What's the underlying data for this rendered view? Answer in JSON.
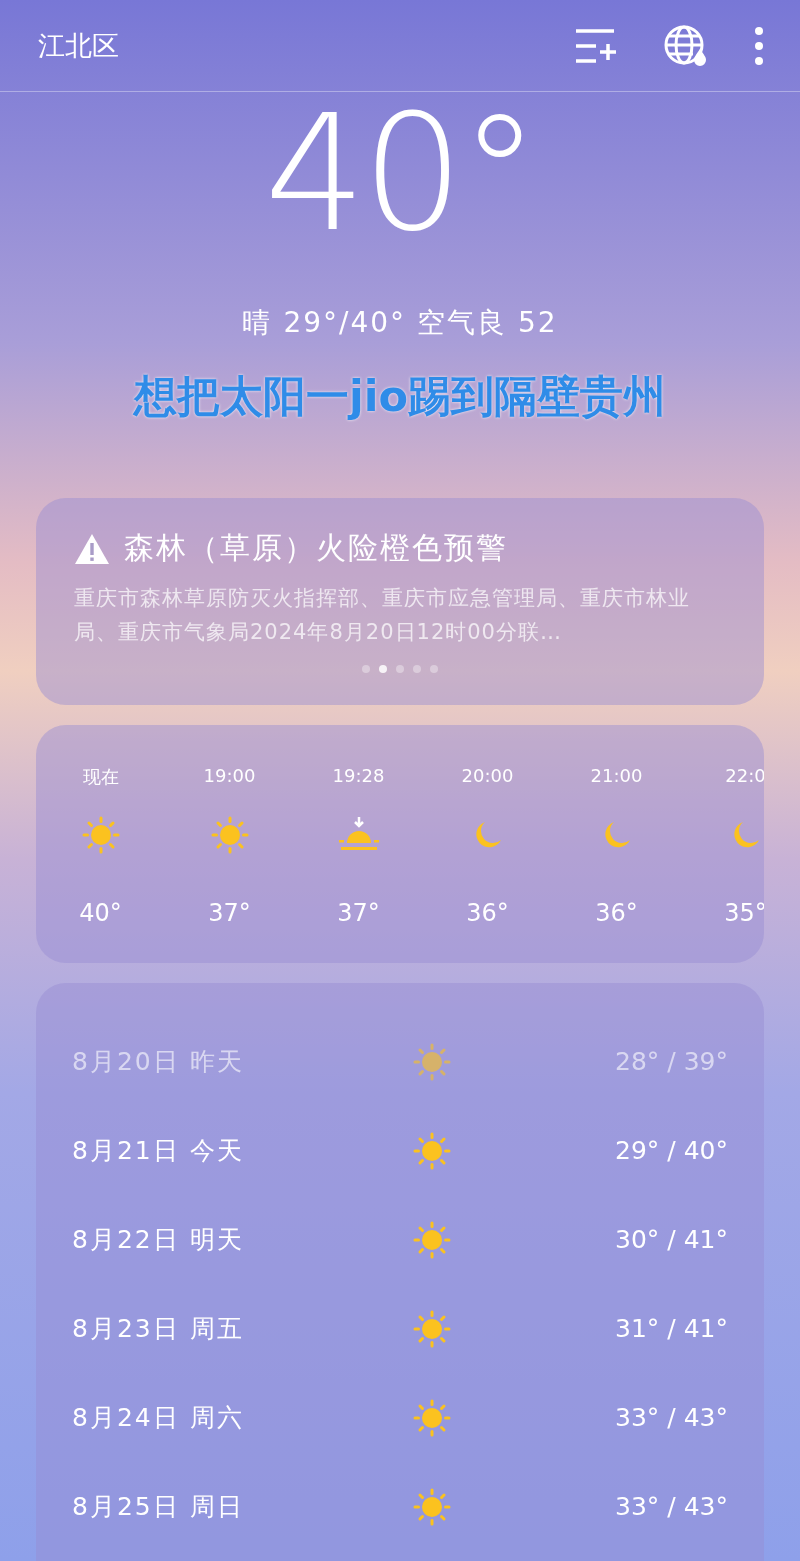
{
  "header": {
    "city": "江北区",
    "actions": [
      {
        "kind": "add-city"
      },
      {
        "kind": "globe"
      },
      {
        "kind": "more"
      }
    ]
  },
  "current": {
    "temperature": "40°",
    "summary": "晴 29°/40° 空气良 52"
  },
  "caption": "想把太阳一jio踢到隔壁贵州",
  "alert": {
    "title": "森林（草原）火险橙色预警",
    "text": "重庆市森林草原防灭火指挥部、重庆市应急管理局、重庆市林业局、重庆市气象局2024年8月20日12时00分联…",
    "pages": [
      {
        "selected": false
      },
      {
        "selected": true
      },
      {
        "selected": false
      },
      {
        "selected": false
      },
      {
        "selected": false
      }
    ]
  },
  "hourly": [
    {
      "time": "现在",
      "kind": "sun",
      "temp": "40°"
    },
    {
      "time": "19:00",
      "kind": "sun",
      "temp": "37°"
    },
    {
      "time": "19:28",
      "kind": "sunset",
      "temp": "37°"
    },
    {
      "time": "20:00",
      "kind": "moon",
      "temp": "36°"
    },
    {
      "time": "21:00",
      "kind": "moon",
      "temp": "36°"
    },
    {
      "time": "22:0",
      "kind": "moon",
      "temp": "35°"
    }
  ],
  "daily": [
    {
      "date": "8月20日",
      "day": "昨天",
      "kind": "sun",
      "range": "28° / 39°",
      "past": true
    },
    {
      "date": "8月21日",
      "day": "今天",
      "kind": "sun",
      "range": "29° / 40°",
      "past": false
    },
    {
      "date": "8月22日",
      "day": "明天",
      "kind": "sun",
      "range": "30° / 41°",
      "past": false
    },
    {
      "date": "8月23日",
      "day": "周五",
      "kind": "sun",
      "range": "31° / 41°",
      "past": false
    },
    {
      "date": "8月24日",
      "day": "周六",
      "kind": "sun",
      "range": "33° / 43°",
      "past": false
    },
    {
      "date": "8月25日",
      "day": "周日",
      "kind": "sun",
      "range": "33° / 43°",
      "past": false
    }
  ]
}
